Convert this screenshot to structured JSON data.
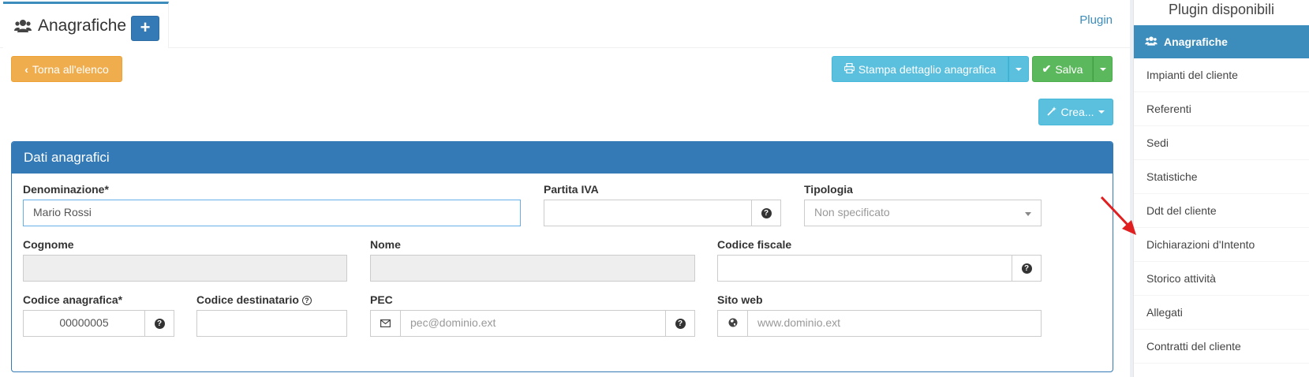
{
  "tabs": {
    "title": "Anagrafiche",
    "add_label": "+",
    "plugin_tab": "Plugin"
  },
  "toolbar": {
    "back_label": "Torna all'elenco",
    "print_label": "Stampa dettaglio anagrafica",
    "save_label": "Salva",
    "create_label": "Crea..."
  },
  "panel": {
    "title": "Dati anagrafici",
    "fields": {
      "denominazione": {
        "label": "Denominazione*",
        "value": "Mario Rossi"
      },
      "partita_iva": {
        "label": "Partita IVA",
        "value": ""
      },
      "tipologia": {
        "label": "Tipologia",
        "value": "Non specificato"
      },
      "cognome": {
        "label": "Cognome",
        "value": ""
      },
      "nome": {
        "label": "Nome",
        "value": ""
      },
      "codice_fiscale": {
        "label": "Codice fiscale",
        "value": ""
      },
      "codice_anagrafica": {
        "label": "Codice anagrafica*",
        "value": "00000005"
      },
      "codice_destinatario": {
        "label": "Codice destinatario",
        "value": ""
      },
      "pec": {
        "label": "PEC",
        "placeholder": "pec@dominio.ext"
      },
      "sito_web": {
        "label": "Sito web",
        "placeholder": "www.dominio.ext"
      }
    }
  },
  "sidebar": {
    "title": "Plugin disponibili",
    "active": "Anagrafiche",
    "items": [
      "Impianti del cliente",
      "Referenti",
      "Sedi",
      "Statistiche",
      "Ddt del cliente",
      "Dichiarazioni d'Intento",
      "Storico attività",
      "Allegati",
      "Contratti del cliente"
    ]
  },
  "colors": {
    "primary": "#337ab7",
    "warning": "#f0ad4e",
    "info": "#5bc0de",
    "success": "#5cb85c",
    "annotation_arrow": "#e02020"
  }
}
